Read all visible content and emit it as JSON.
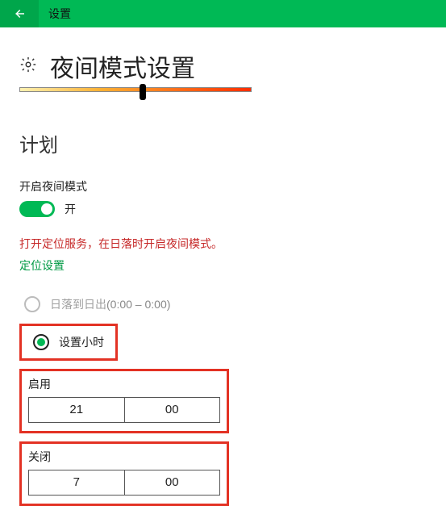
{
  "header": {
    "title": "设置"
  },
  "page": {
    "title": "夜间模式设置"
  },
  "section": {
    "schedule_title": "计划",
    "enable_label": "开启夜间模式",
    "toggle_state": "开"
  },
  "warning_text": "打开定位服务，在日落时开启夜间模式。",
  "link_text": "定位设置",
  "radio": {
    "sunset": {
      "label": "日落到日出",
      "range": "(0:00 – 0:00)"
    },
    "manual": {
      "label": "设置小时"
    }
  },
  "time_on": {
    "label": "启用",
    "hour": "21",
    "minute": "00"
  },
  "time_off": {
    "label": "关闭",
    "hour": "7",
    "minute": "00"
  }
}
